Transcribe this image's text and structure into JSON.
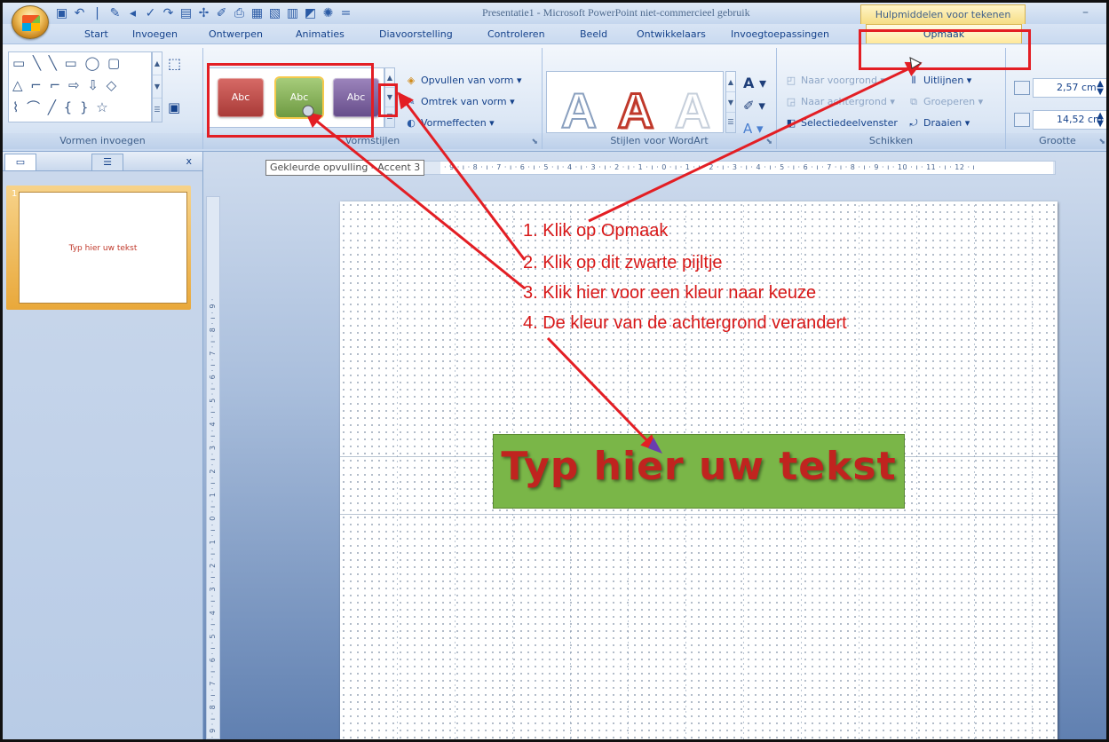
{
  "window": {
    "title": "Presentatie1 - Microsoft PowerPoint niet-commercieel gebruik",
    "context_header": "Hulpmiddelen voor tekenen",
    "minimize": "–"
  },
  "qat": {
    "separator": "|",
    "more": "="
  },
  "tabs": [
    "Start",
    "Invoegen",
    "Ontwerpen",
    "Animaties",
    "Diavoorstelling",
    "Controleren",
    "Beeld",
    "Ontwikkelaars",
    "Invoegtoepassingen"
  ],
  "active_tab": "Opmaak",
  "ribbon": {
    "shapes_group_label": "Vormen invoegen",
    "shape_rows": [
      "▭ ╲ ╲ ▭ ◯ ▢",
      "△ ⌐ ⌐ ⇨ ⇩ ◇",
      "⌇ ⌒ ╱ { } ☆"
    ],
    "vormstijlen": {
      "label": "Vormstijlen",
      "swatches": [
        {
          "text": "Abc",
          "color": "#c0504d"
        },
        {
          "text": "Abc",
          "color": "#8ab55a"
        },
        {
          "text": "Abc",
          "color": "#8064a2"
        }
      ],
      "fill": "Opvullen van vorm",
      "outline": "Omtrek van vorm",
      "effects": "Vormeffecten"
    },
    "wordart": {
      "label": "Stijlen voor WordArt",
      "letter": "A"
    },
    "schikken": {
      "label": "Schikken",
      "bring_forward": "Naar voorgrond",
      "send_back": "Naar achtergrond",
      "selection_pane": "Selectiedeelvenster",
      "align": "Uitlijnen",
      "group": "Groeperen",
      "rotate": "Draaien"
    },
    "grootte": {
      "label": "Grootte",
      "height": "2,57 cm",
      "width": "14,52 cm"
    }
  },
  "tooltip": "Gekleurde opvulling - Accent 3",
  "ruler": {
    "horizontal": "· 9 · ı · 8 · ı · 7 · ı · 6 · ı · 5 · ı · 4 · ı · 3 · ı · 2 · ı · 1 · ı · 0 · ı · 1 · ı · 2 · ı · 3 · ı · 4 · ı · 5 · ı · 6 · ı · 7 · ı · 8 · ı · 9 · ı · 10 · ı · 11 · ı · 12 · ı",
    "vertical": "· 9 · ı · 8 · ı · 7 · ı · 6 · ı · 5 · ı · 4 · ı · 3 · ı · 2 · ı · 1 · ı · 0 · ı · 1 · ı · 2 · ı · 3 · ı · 4 · ı · 5 · ı · 6 · ı · 7 · ı · 8 · ı · 9 ·"
  },
  "slides_panel": {
    "close": "x",
    "slide_number": "1",
    "thumb_text": "Typ hier uw tekst"
  },
  "slide": {
    "instructions": [
      "1. Klik op Opmaak",
      "2. Klik op dit zwarte pijltje",
      "3. Klik hier voor een kleur naar keuze",
      "4. De kleur van de achtergrond verandert"
    ],
    "textbox": "Typ hier uw tekst"
  },
  "colors": {
    "annotation_red": "#e31e24",
    "textbox_fill": "#7ab648",
    "textbox_text": "#c0241f"
  }
}
